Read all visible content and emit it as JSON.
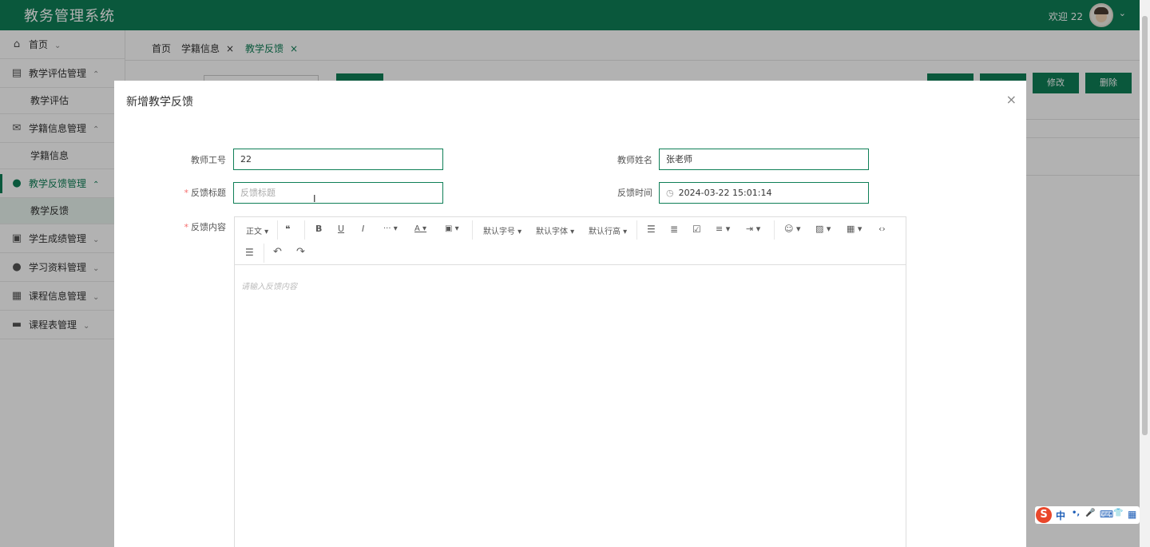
{
  "header": {
    "brand": "教务管理系统",
    "welcome": "欢迎 22",
    "chevron": "⌄"
  },
  "sidebar": {
    "items": [
      {
        "label": "首页",
        "icon": "⌂",
        "arrow": "⌄"
      },
      {
        "label": "教学评估管理",
        "icon": "▤",
        "arrow": "⌃"
      },
      {
        "label": "教学评估"
      },
      {
        "label": "学籍信息管理",
        "icon": "✉",
        "arrow": "⌃"
      },
      {
        "label": "学籍信息"
      },
      {
        "label": "教学反馈管理",
        "icon": "●",
        "arrow": "⌃"
      },
      {
        "label": "教学反馈"
      },
      {
        "label": "学生成绩管理",
        "icon": "▣",
        "arrow": "⌄"
      },
      {
        "label": "学习资料管理",
        "icon": "●",
        "arrow": "⌄"
      },
      {
        "label": "课程信息管理",
        "icon": "▦",
        "arrow": "⌄"
      },
      {
        "label": "课程表管理",
        "icon": "▬",
        "arrow": "⌄"
      }
    ]
  },
  "tabs": [
    {
      "label": "首页",
      "close": ""
    },
    {
      "label": "学籍信息",
      "close": "×"
    },
    {
      "label": "教学反馈",
      "close": "×"
    }
  ],
  "background_buttons": {
    "edit": "修改",
    "delete": "删除"
  },
  "dialog": {
    "title": "新增教学反馈",
    "close": "×",
    "fields": {
      "teacher_id": {
        "label": "教师工号",
        "value": "22"
      },
      "teacher_name": {
        "label": "教师姓名",
        "value": "张老师"
      },
      "feedback_title": {
        "label": "反馈标题",
        "required": "*",
        "placeholder": "反馈标题"
      },
      "feedback_time": {
        "label": "反馈时间",
        "value": "2024-03-22 15:01:14"
      },
      "feedback_content": {
        "label": "反馈内容",
        "required": "*",
        "placeholder": "请输入反馈内容"
      }
    },
    "toolbar": {
      "paragraph": "正文 ▾",
      "quote": "❝",
      "bold": "B",
      "underline": "U",
      "italic": "I",
      "more": "··· ▾",
      "font_color": "A ▾",
      "bg_color": "▣ ▾",
      "font_size": "默认字号 ▾",
      "font_family": "默认字体 ▾",
      "line_height": "默认行高 ▾",
      "bullet_list": "☰",
      "numbered_list": "≣",
      "todo": "☑",
      "align": "≡ ▾",
      "indent": "⇥ ▾",
      "emoji": "☺ ▾",
      "image": "▨ ▾",
      "table": "▦ ▾",
      "code": "‹›",
      "divider": "☰",
      "undo": "↶",
      "redo": "↷"
    }
  },
  "ime": {
    "logo": "S",
    "lang": "中",
    "punct": "•,",
    "mic": "🎤",
    "keyboard": "⌨",
    "skin": "👕",
    "apps": "▦"
  }
}
